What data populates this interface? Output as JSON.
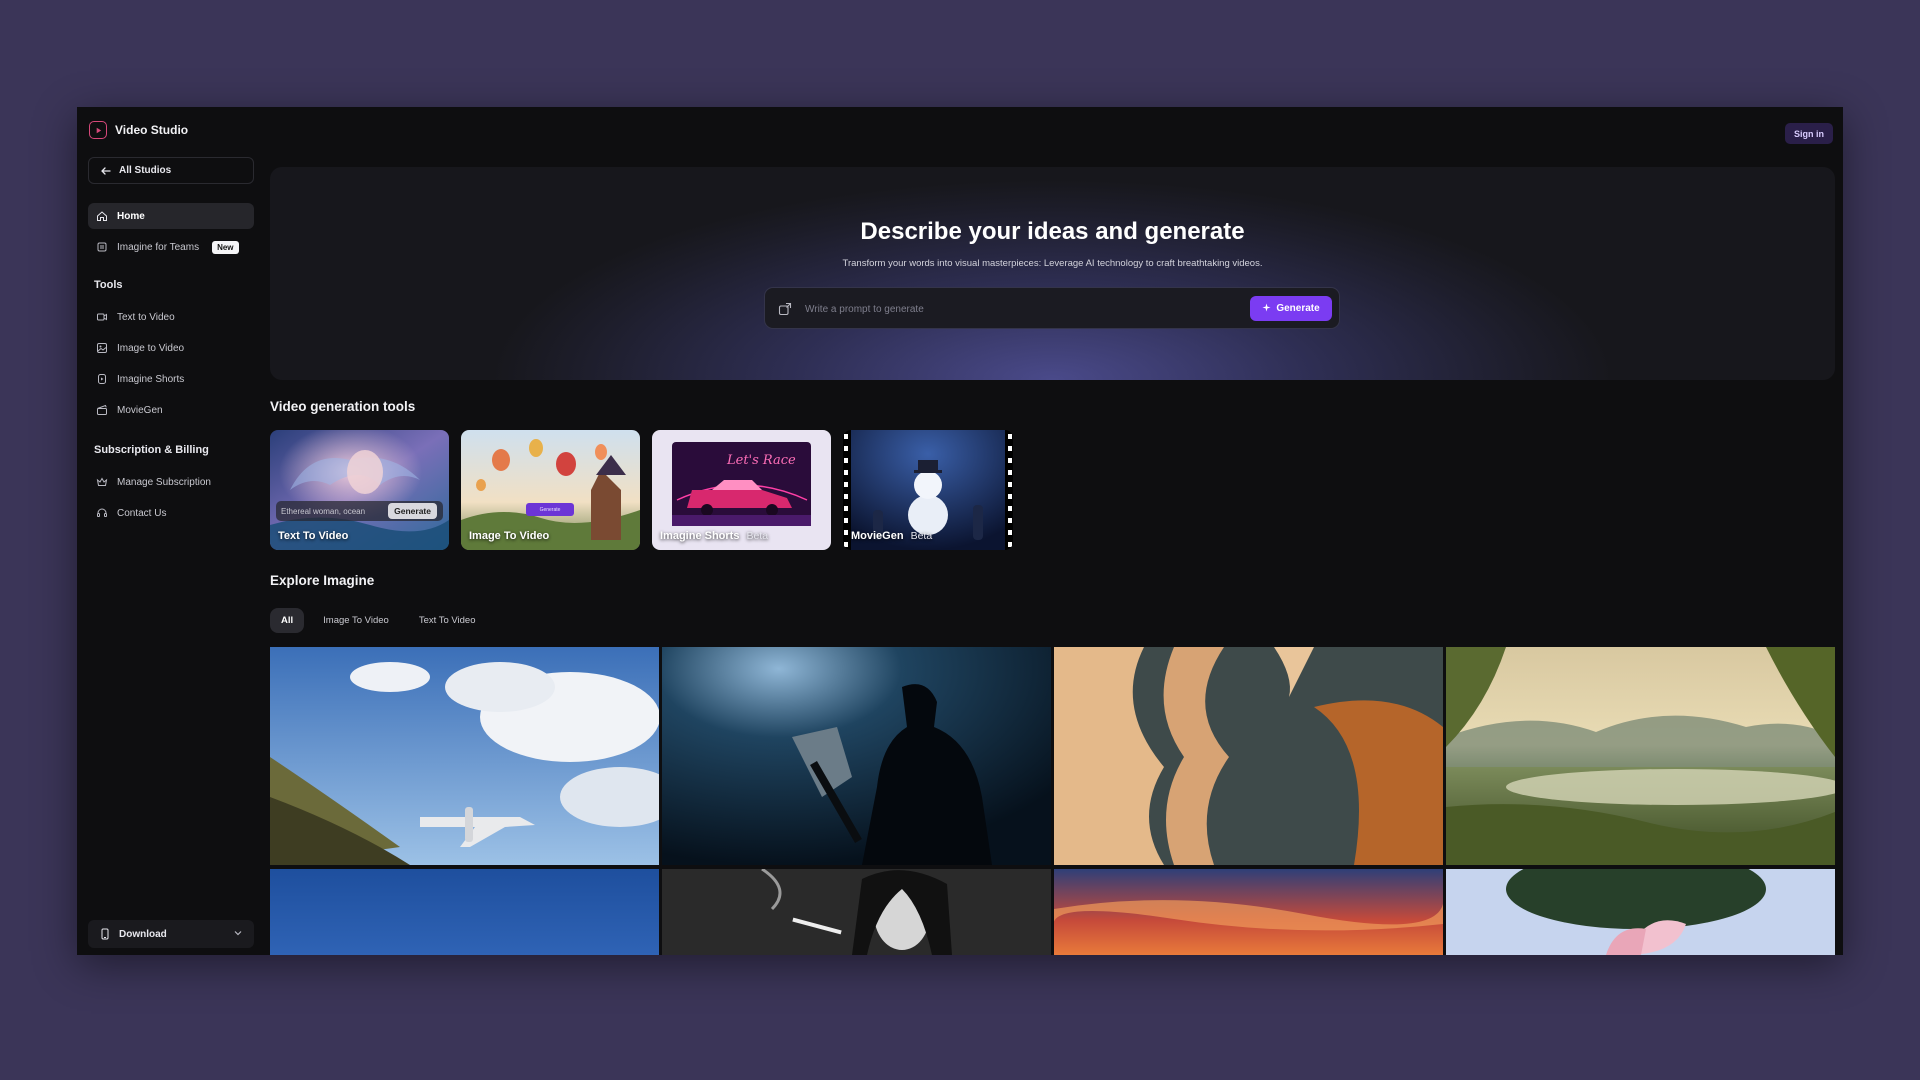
{
  "app": {
    "title": "Video Studio",
    "accent": "#7b3cf2",
    "logo_color": "#d6487a"
  },
  "header": {
    "signin_label": "Sign in"
  },
  "sidebar": {
    "back_label": "All Studios",
    "main_items": [
      {
        "label": "Home",
        "icon": "home-icon",
        "active": true
      },
      {
        "label": "Imagine for Teams",
        "icon": "team-icon",
        "badge": "New"
      }
    ],
    "tools_title": "Tools",
    "tools": [
      {
        "label": "Text to Video",
        "icon": "text-video-icon"
      },
      {
        "label": "Image to Video",
        "icon": "image-video-icon"
      },
      {
        "label": "Imagine Shorts",
        "icon": "shorts-icon"
      },
      {
        "label": "MovieGen",
        "icon": "moviegen-icon"
      }
    ],
    "billing_title": "Subscription & Billing",
    "billing": [
      {
        "label": "Manage Subscription",
        "icon": "crown-icon"
      },
      {
        "label": "Contact Us",
        "icon": "headset-icon"
      }
    ],
    "download_label": "Download"
  },
  "hero": {
    "title": "Describe your ideas and generate",
    "subtitle": "Transform your words into visual masterpieces: Leverage AI technology to craft breathtaking videos.",
    "placeholder": "Write a prompt to generate",
    "generate_label": "Generate"
  },
  "tools_section": {
    "title": "Video generation tools",
    "cards": [
      {
        "label": "Text To Video",
        "prompt_text": "Ethereal woman, ocean",
        "prompt_button": "Generate"
      },
      {
        "label": "Image To Video",
        "mini_button": "Generate"
      },
      {
        "label": "Imagine Shorts",
        "beta": "Beta",
        "neon_text": "Let's Race"
      },
      {
        "label": "MovieGen",
        "beta": "Beta"
      }
    ]
  },
  "explore": {
    "title": "Explore Imagine",
    "tabs": [
      {
        "label": "All",
        "active": true
      },
      {
        "label": "Image To Video"
      },
      {
        "label": "Text To Video"
      }
    ]
  }
}
